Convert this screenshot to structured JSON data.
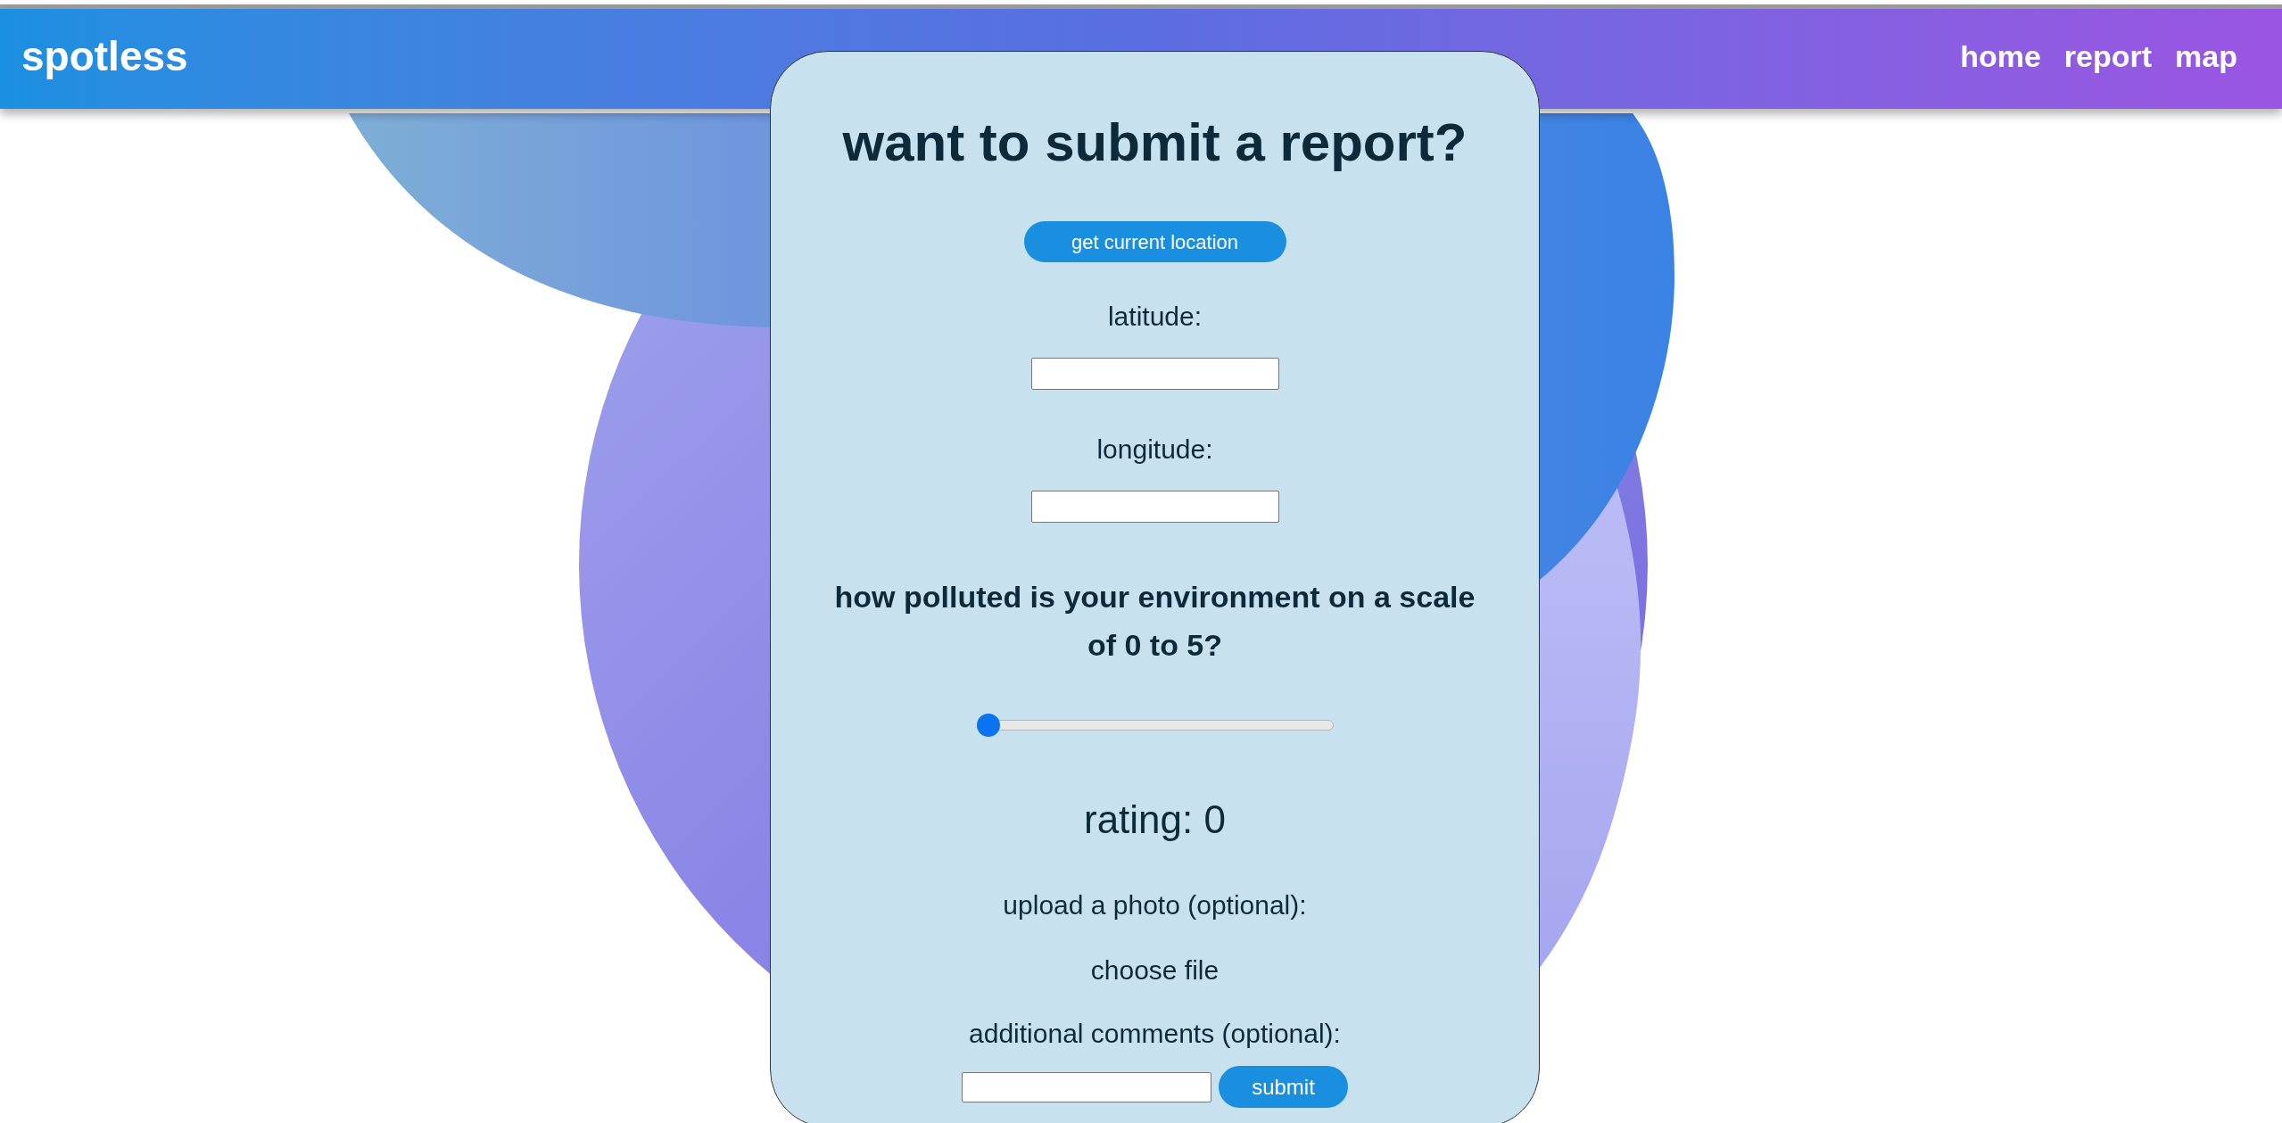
{
  "nav": {
    "brand": "spotless",
    "links": [
      "home",
      "report",
      "map"
    ]
  },
  "form": {
    "title": "want to submit a report?",
    "location_button": "get current location",
    "fields": [
      {
        "label": "latitude:"
      },
      {
        "label": "longitude:"
      }
    ],
    "question": "how polluted is your environment on a scale of 0 to 5?",
    "slider": {
      "level": 0
    },
    "rating": "rating: 0",
    "upload_label": "upload a photo (optional):",
    "file_button": "choose file",
    "comments_label": "additional comments (optional):",
    "submit": "submit"
  }
}
